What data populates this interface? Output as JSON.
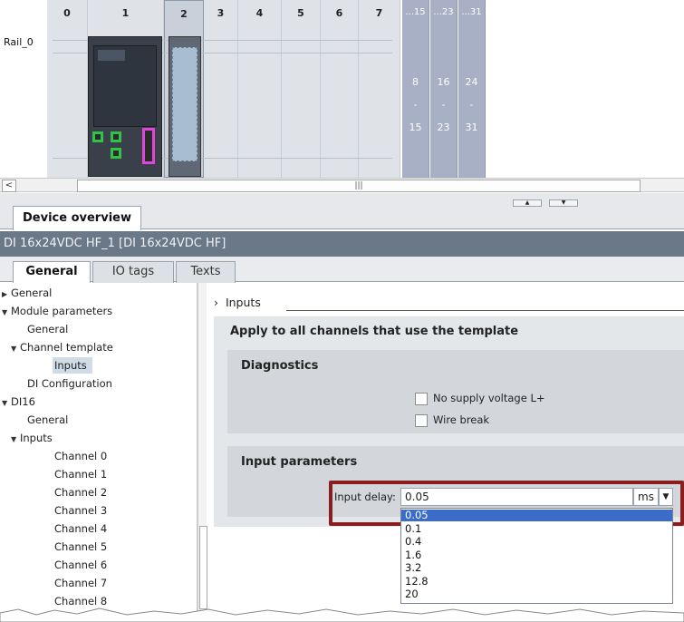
{
  "rack": {
    "rail_label": "Rail_0",
    "slots": [
      "0",
      "1",
      "2",
      "3",
      "4",
      "5",
      "6",
      "7"
    ],
    "groups": [
      {
        "header": "...15",
        "labels": [
          "8",
          "-",
          "15"
        ]
      },
      {
        "header": "...23",
        "labels": [
          "16",
          "-",
          "23"
        ]
      },
      {
        "header": "...31",
        "labels": [
          "24",
          "-",
          "31"
        ]
      }
    ]
  },
  "scrollbar": {
    "left_arrow": "<",
    "grip": "|||"
  },
  "tabs": {
    "device_overview": "Device overview"
  },
  "title_bar": "DI 16x24VDC HF_1 [DI 16x24VDC HF]",
  "property_tabs": [
    "General",
    "IO tags",
    "Texts"
  ],
  "tree": [
    {
      "label": "General",
      "indent": 0,
      "toggle": "▶"
    },
    {
      "label": "Module parameters",
      "indent": 0,
      "toggle": "▼"
    },
    {
      "label": "General",
      "indent": 2,
      "toggle": ""
    },
    {
      "label": "Channel template",
      "indent": 1,
      "toggle": "▼"
    },
    {
      "label": "Inputs",
      "indent": 3,
      "toggle": "",
      "selected": true
    },
    {
      "label": "DI Configuration",
      "indent": 2,
      "toggle": ""
    },
    {
      "label": "DI16",
      "indent": 0,
      "toggle": "▼"
    },
    {
      "label": "General",
      "indent": 2,
      "toggle": ""
    },
    {
      "label": "Inputs",
      "indent": 1,
      "toggle": "▼"
    },
    {
      "label": "Channel 0",
      "indent": 3,
      "toggle": ""
    },
    {
      "label": "Channel 1",
      "indent": 3,
      "toggle": ""
    },
    {
      "label": "Channel 2",
      "indent": 3,
      "toggle": ""
    },
    {
      "label": "Channel 3",
      "indent": 3,
      "toggle": ""
    },
    {
      "label": "Channel 4",
      "indent": 3,
      "toggle": ""
    },
    {
      "label": "Channel 5",
      "indent": 3,
      "toggle": ""
    },
    {
      "label": "Channel 6",
      "indent": 3,
      "toggle": ""
    },
    {
      "label": "Channel 7",
      "indent": 3,
      "toggle": ""
    },
    {
      "label": "Channel 8",
      "indent": 3,
      "toggle": ""
    }
  ],
  "content": {
    "section_header": "Inputs",
    "apply_title": "Apply to all channels that use the template",
    "diagnostics": {
      "title": "Diagnostics",
      "no_supply": "No supply voltage L+",
      "wire_break": "Wire break"
    },
    "input_params": {
      "title": "Input parameters",
      "delay_label": "Input delay:",
      "delay_value": "0.05",
      "unit": "ms",
      "options": [
        "0.05",
        "0.1",
        "0.4",
        "1.6",
        "3.2",
        "12.8",
        "20"
      ],
      "highlighted": "0.05"
    }
  },
  "colors": {
    "title_bar": "#6b7888",
    "highlight_frame": "#8a1e1e",
    "selected_option": "#3a6cc8",
    "port_green": "#31c24a",
    "port_magenta": "#e044d8"
  }
}
